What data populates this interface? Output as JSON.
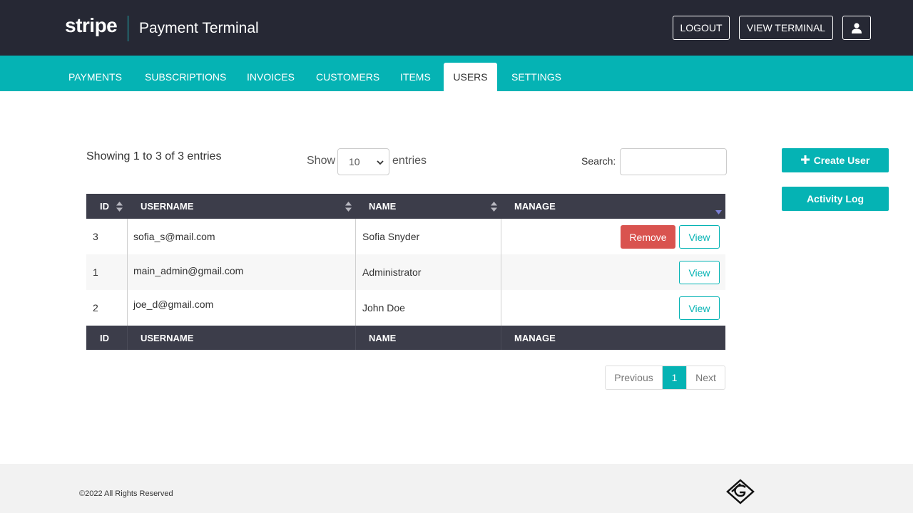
{
  "header": {
    "logo": "stripe",
    "title": "Payment Terminal",
    "logout_label": "LOGOUT",
    "view_terminal_label": "VIEW TERMINAL",
    "user_icon": "user-icon"
  },
  "nav": {
    "items": [
      {
        "label": "PAYMENTS",
        "active": false
      },
      {
        "label": "SUBSCRIPTIONS",
        "active": false
      },
      {
        "label": "INVOICES",
        "active": false
      },
      {
        "label": "CUSTOMERS",
        "active": false
      },
      {
        "label": "ITEMS",
        "active": false
      },
      {
        "label": "USERS",
        "active": true
      },
      {
        "label": "SETTINGS",
        "active": false
      }
    ]
  },
  "controls": {
    "showing_text": "Showing 1 to 3 of 3 entries",
    "show_label": "Show",
    "page_size": "10",
    "entries_label": "entries",
    "search_label": "Search:",
    "search_value": ""
  },
  "side": {
    "create_user_label": "Create User",
    "activity_log_label": "Activity Log"
  },
  "table": {
    "headers": [
      "ID",
      "USERNAME",
      "NAME",
      "MANAGE"
    ],
    "rows": [
      {
        "id": "3",
        "username": "sofia_s@mail.com",
        "name": "Sofia Snyder",
        "remove_label": "Remove",
        "view_label": "View"
      },
      {
        "id": "1",
        "username": "main_admin@gmail.com",
        "name": "Administrator",
        "view_label": "View"
      },
      {
        "id": "2",
        "username": "joe_d@gmail.com",
        "name": "John Doe",
        "view_label": "View"
      }
    ]
  },
  "pagination": {
    "previous_label": "Previous",
    "current_page": "1",
    "next_label": "Next"
  },
  "footer": {
    "copyright": "©2022 All Rights Reserved"
  },
  "colors": {
    "header_bg": "#262834",
    "accent": "#05b3b4",
    "table_header_bg": "#3c3d4a",
    "danger": "#d9534f"
  }
}
